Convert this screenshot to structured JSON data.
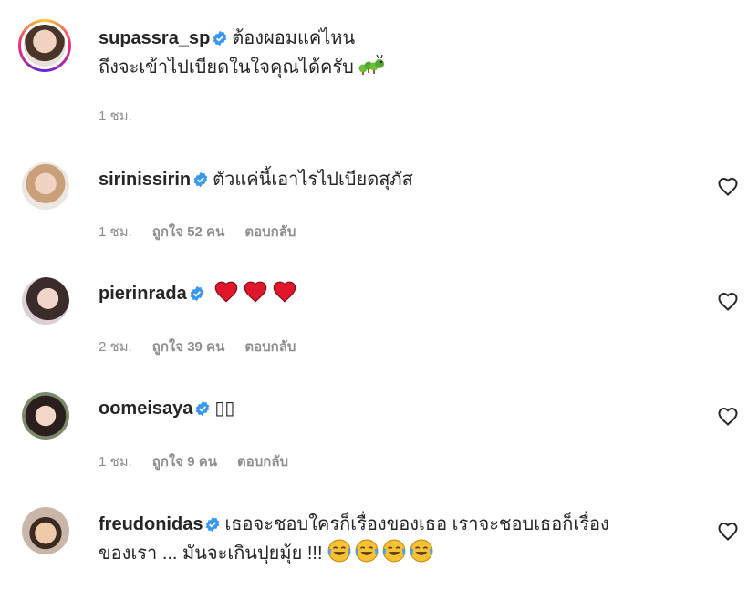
{
  "comments": [
    {
      "username": "supassra_sp",
      "text_line1": "ต้องผอมแค่ไหน",
      "text_line2": "ถึงจะเข้าไปเบียดในใจคุณได้ครับ",
      "time": "1 ชม.",
      "likes": "",
      "reply": ""
    },
    {
      "username": "sirinissirin",
      "text_line1": "ตัวแค่นี้เอาไรไปเบียดสุภัส",
      "time": "1 ชม.",
      "likes": "ถูกใจ 52 คน",
      "reply": "ตอบกลับ"
    },
    {
      "username": "pierinrada",
      "text_line1": "",
      "time": "2 ชม.",
      "likes": "ถูกใจ 39 คน",
      "reply": "ตอบกลับ"
    },
    {
      "username": "oomeisaya",
      "text_line1": "▯▯",
      "time": "1 ชม.",
      "likes": "ถูกใจ 9 คน",
      "reply": "ตอบกลับ"
    },
    {
      "username": "freudonidas",
      "text_line1": "เธอจะชอบใครก็เรื่องของเธอ เราจะชอบเธอก็เรื่อง",
      "text_line2": "ของเรา ... มันจะเกินปุยมุ้ย !!!",
      "time": "",
      "likes": "",
      "reply": ""
    }
  ],
  "icons": {
    "verified": "verified-badge-icon",
    "like": "heart-outline-icon",
    "heart_emoji": "red-heart-emoji",
    "laugh_emoji": "tears-of-joy-emoji",
    "caterpillar_emoji": "caterpillar-emoji"
  },
  "colors": {
    "verified": "#3897f0",
    "meta": "#8e8e8e",
    "text": "#262626",
    "heart_emoji": "#e0162b",
    "laugh_emoji": "#f6c234"
  }
}
